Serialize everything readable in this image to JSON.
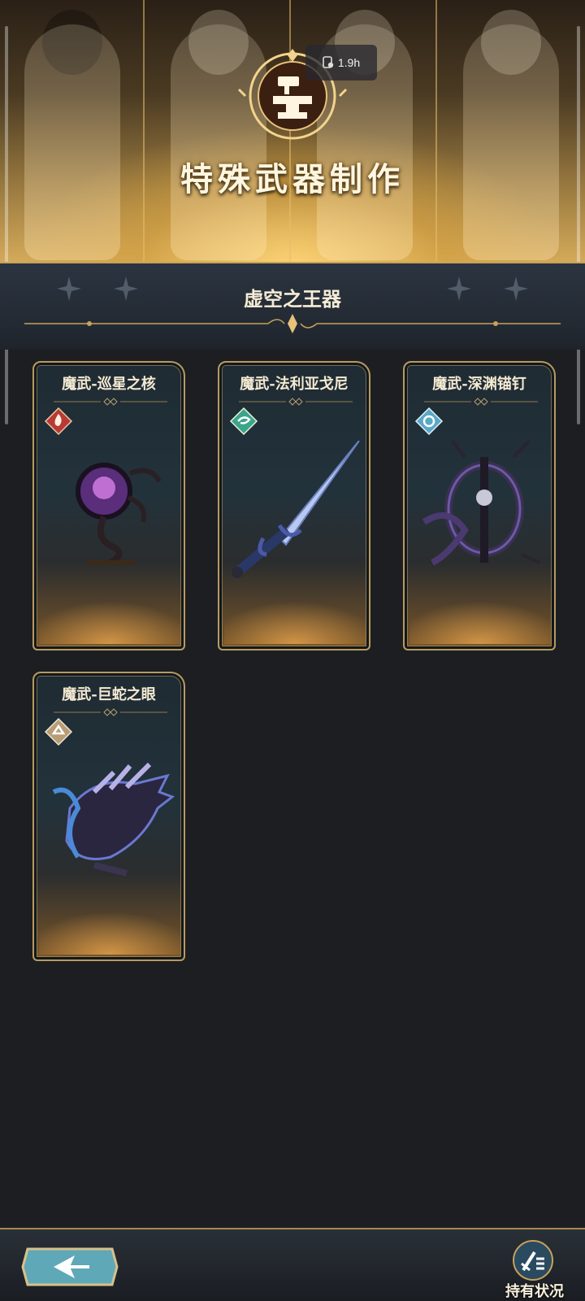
{
  "banner": {
    "title": "特殊武器制作",
    "timer": "1.9h",
    "timer_icon": "fatigue-icon"
  },
  "section": {
    "title": "虚空之王器"
  },
  "cards": [
    {
      "name": "魔武-巡星之核",
      "element_icon": "fire-element-icon",
      "element_color": "#b83a36"
    },
    {
      "name": "魔武-法利亚戈尼",
      "element_icon": "wind-element-icon",
      "element_color": "#3aa58a"
    },
    {
      "name": "魔武-深渊锚钉",
      "element_icon": "water-element-icon",
      "element_color": "#5aa8c8"
    },
    {
      "name": "魔武-巨蛇之眼",
      "element_icon": "earth-element-icon",
      "element_color": "#b89c76"
    }
  ],
  "bottombar": {
    "back_icon": "back-arrow-icon",
    "holdings_label": "持有状况",
    "holdings_icon": "sword-list-icon"
  },
  "colors": {
    "gold": "#c8a25a",
    "background": "#1c1e22"
  }
}
